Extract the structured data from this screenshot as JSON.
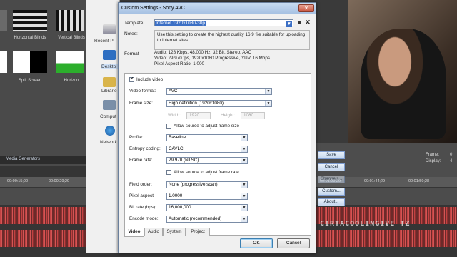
{
  "dialog": {
    "title": "Custom Settings - Sony AVC",
    "template_label": "Template:",
    "template_value": "Internet 1920x1080-30p",
    "notes_label": "Notes:",
    "notes_text": "Use this setting to create the highest quality 16:9 file suitable for uploading to Internet sites.",
    "format_label": "Format",
    "format_lines": [
      "Audio: 128 Kbps, 48,000 Hz, 32 Bit, Stereo, AAC",
      "Video: 29.970 fps, 1920x1080 Progressive, YUV, 16 Mbps",
      "Pixel Aspect Ratio: 1.000"
    ],
    "include_video_label": "Include video",
    "fields": {
      "video_format": {
        "label": "Video format:",
        "value": "AVC"
      },
      "frame_size": {
        "label": "Frame size:",
        "value": "High definition (1920x1080)"
      },
      "width": {
        "label": "Width:",
        "value": "1920"
      },
      "height": {
        "label": "Height:",
        "value": "1080"
      },
      "allow_frame_size": "Allow source to adjust frame size",
      "profile": {
        "label": "Profile:",
        "value": "Baseline"
      },
      "entropy": {
        "label": "Entropy coding:",
        "value": "CAVLC"
      },
      "frame_rate": {
        "label": "Frame rate:",
        "value": "29.970 (NTSC)"
      },
      "allow_frame_rate": "Allow source to adjust frame rate",
      "field_order": {
        "label": "Field order:",
        "value": "None (progressive scan)"
      },
      "pixel_aspect": {
        "label": "Pixel aspect",
        "value": "1.0000"
      },
      "bit_rate": {
        "label": "Bit rate (bps):",
        "value": "16,000,000"
      },
      "encode_mode": {
        "label": "Encode mode:",
        "value": "Automatic (recommended)"
      }
    },
    "tabs": [
      "Video",
      "Audio",
      "System",
      "Project"
    ],
    "ok": "OK",
    "cancel": "Cancel"
  },
  "explorer": {
    "items": [
      "Recent Pl",
      "Deskto",
      "Librarie",
      "Comput",
      "Network"
    ]
  },
  "vegas": {
    "fx": [
      "Horizontal Blinds",
      "Vertical Blinds",
      "Split Screen",
      "Horizon"
    ],
    "media_generators": "Media Generators",
    "ruler": [
      "00:00:15;00",
      "00:00:29;29",
      "00:01:29;29",
      "00:01:44;29",
      "00:01:59;28"
    ],
    "right_buttons": [
      "Save",
      "Cancel",
      "Channels...",
      "Custom...",
      "About..."
    ],
    "frame_label": "Frame:",
    "frame_value": "0",
    "display_label": "Display:",
    "display_value": "4",
    "watermark": "CIRTACOOLINGIVE TZ"
  }
}
